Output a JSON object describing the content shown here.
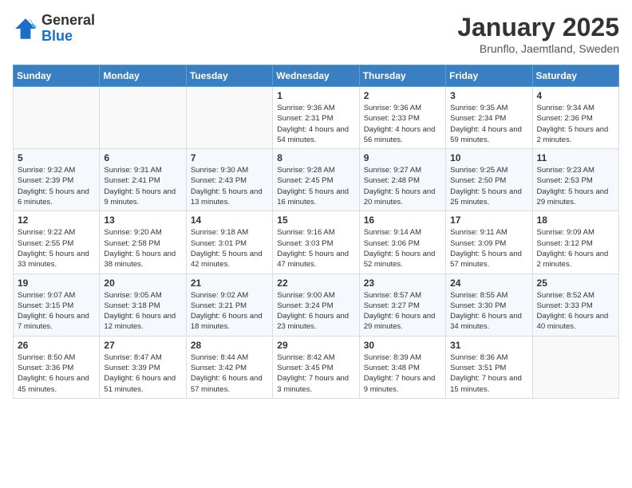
{
  "logo": {
    "general": "General",
    "blue": "Blue"
  },
  "header": {
    "month": "January 2025",
    "location": "Brunflo, Jaemtland, Sweden"
  },
  "weekdays": [
    "Sunday",
    "Monday",
    "Tuesday",
    "Wednesday",
    "Thursday",
    "Friday",
    "Saturday"
  ],
  "weeks": [
    [
      {
        "day": "",
        "info": ""
      },
      {
        "day": "",
        "info": ""
      },
      {
        "day": "",
        "info": ""
      },
      {
        "day": "1",
        "info": "Sunrise: 9:36 AM\nSunset: 2:31 PM\nDaylight: 4 hours and 54 minutes."
      },
      {
        "day": "2",
        "info": "Sunrise: 9:36 AM\nSunset: 2:33 PM\nDaylight: 4 hours and 56 minutes."
      },
      {
        "day": "3",
        "info": "Sunrise: 9:35 AM\nSunset: 2:34 PM\nDaylight: 4 hours and 59 minutes."
      },
      {
        "day": "4",
        "info": "Sunrise: 9:34 AM\nSunset: 2:36 PM\nDaylight: 5 hours and 2 minutes."
      }
    ],
    [
      {
        "day": "5",
        "info": "Sunrise: 9:32 AM\nSunset: 2:39 PM\nDaylight: 5 hours and 6 minutes."
      },
      {
        "day": "6",
        "info": "Sunrise: 9:31 AM\nSunset: 2:41 PM\nDaylight: 5 hours and 9 minutes."
      },
      {
        "day": "7",
        "info": "Sunrise: 9:30 AM\nSunset: 2:43 PM\nDaylight: 5 hours and 13 minutes."
      },
      {
        "day": "8",
        "info": "Sunrise: 9:28 AM\nSunset: 2:45 PM\nDaylight: 5 hours and 16 minutes."
      },
      {
        "day": "9",
        "info": "Sunrise: 9:27 AM\nSunset: 2:48 PM\nDaylight: 5 hours and 20 minutes."
      },
      {
        "day": "10",
        "info": "Sunrise: 9:25 AM\nSunset: 2:50 PM\nDaylight: 5 hours and 25 minutes."
      },
      {
        "day": "11",
        "info": "Sunrise: 9:23 AM\nSunset: 2:53 PM\nDaylight: 5 hours and 29 minutes."
      }
    ],
    [
      {
        "day": "12",
        "info": "Sunrise: 9:22 AM\nSunset: 2:55 PM\nDaylight: 5 hours and 33 minutes."
      },
      {
        "day": "13",
        "info": "Sunrise: 9:20 AM\nSunset: 2:58 PM\nDaylight: 5 hours and 38 minutes."
      },
      {
        "day": "14",
        "info": "Sunrise: 9:18 AM\nSunset: 3:01 PM\nDaylight: 5 hours and 42 minutes."
      },
      {
        "day": "15",
        "info": "Sunrise: 9:16 AM\nSunset: 3:03 PM\nDaylight: 5 hours and 47 minutes."
      },
      {
        "day": "16",
        "info": "Sunrise: 9:14 AM\nSunset: 3:06 PM\nDaylight: 5 hours and 52 minutes."
      },
      {
        "day": "17",
        "info": "Sunrise: 9:11 AM\nSunset: 3:09 PM\nDaylight: 5 hours and 57 minutes."
      },
      {
        "day": "18",
        "info": "Sunrise: 9:09 AM\nSunset: 3:12 PM\nDaylight: 6 hours and 2 minutes."
      }
    ],
    [
      {
        "day": "19",
        "info": "Sunrise: 9:07 AM\nSunset: 3:15 PM\nDaylight: 6 hours and 7 minutes."
      },
      {
        "day": "20",
        "info": "Sunrise: 9:05 AM\nSunset: 3:18 PM\nDaylight: 6 hours and 12 minutes."
      },
      {
        "day": "21",
        "info": "Sunrise: 9:02 AM\nSunset: 3:21 PM\nDaylight: 6 hours and 18 minutes."
      },
      {
        "day": "22",
        "info": "Sunrise: 9:00 AM\nSunset: 3:24 PM\nDaylight: 6 hours and 23 minutes."
      },
      {
        "day": "23",
        "info": "Sunrise: 8:57 AM\nSunset: 3:27 PM\nDaylight: 6 hours and 29 minutes."
      },
      {
        "day": "24",
        "info": "Sunrise: 8:55 AM\nSunset: 3:30 PM\nDaylight: 6 hours and 34 minutes."
      },
      {
        "day": "25",
        "info": "Sunrise: 8:52 AM\nSunset: 3:33 PM\nDaylight: 6 hours and 40 minutes."
      }
    ],
    [
      {
        "day": "26",
        "info": "Sunrise: 8:50 AM\nSunset: 3:36 PM\nDaylight: 6 hours and 45 minutes."
      },
      {
        "day": "27",
        "info": "Sunrise: 8:47 AM\nSunset: 3:39 PM\nDaylight: 6 hours and 51 minutes."
      },
      {
        "day": "28",
        "info": "Sunrise: 8:44 AM\nSunset: 3:42 PM\nDaylight: 6 hours and 57 minutes."
      },
      {
        "day": "29",
        "info": "Sunrise: 8:42 AM\nSunset: 3:45 PM\nDaylight: 7 hours and 3 minutes."
      },
      {
        "day": "30",
        "info": "Sunrise: 8:39 AM\nSunset: 3:48 PM\nDaylight: 7 hours and 9 minutes."
      },
      {
        "day": "31",
        "info": "Sunrise: 8:36 AM\nSunset: 3:51 PM\nDaylight: 7 hours and 15 minutes."
      },
      {
        "day": "",
        "info": ""
      }
    ]
  ]
}
